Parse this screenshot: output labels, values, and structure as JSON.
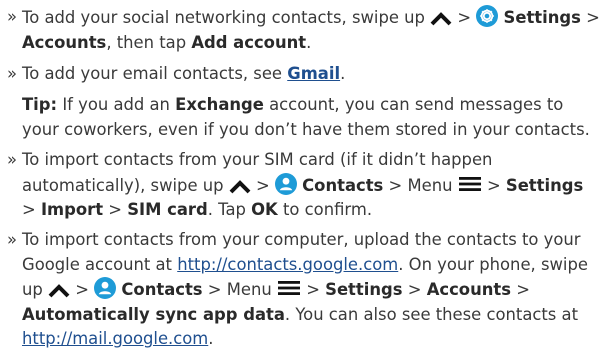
{
  "bullet_mark": "»",
  "item1": {
    "t1": "To add your social networking contacts, swipe up",
    "sep1": ">",
    "settings": "Settings",
    "sep2": ">",
    "accounts": "Accounts",
    "t2": ", then tap",
    "add_account": "Add account",
    "t3": "."
  },
  "item2": {
    "t1": "To add your email contacts, see",
    "gmail": "Gmail",
    "t2": "."
  },
  "tip": {
    "label": "Tip:",
    "t1": "If you add an",
    "exchange": "Exchange",
    "t2": "account, you can send messages to your coworkers, even if you don’t have them stored in your contacts."
  },
  "item3": {
    "t1": "To import contacts from your SIM card (if it didn’t happen automatically), swipe up",
    "sep1": ">",
    "contacts": "Contacts",
    "sep2": "> Menu",
    "sep3": ">",
    "settings": "Settings",
    "sep4": ">",
    "import": "Import",
    "sep5": ">",
    "sim_card": "SIM card",
    "t2": ". Tap",
    "ok": "OK",
    "t3": "to confirm."
  },
  "item4": {
    "t1": "To import contacts from your computer, upload the contacts to your Google account at",
    "url1": "http://contacts.google.com",
    "t2": ". On your phone, swipe up",
    "sep1": ">",
    "contacts": "Contacts",
    "sep2": "> Menu",
    "sep3": ">",
    "settings": "Settings",
    "sep4": ">",
    "accounts": "Accounts",
    "sep5": ">",
    "auto_sync": "Automatically sync app data",
    "t3": ". You can also see these contacts at",
    "url2": "http://mail.google.com",
    "t4": "."
  }
}
